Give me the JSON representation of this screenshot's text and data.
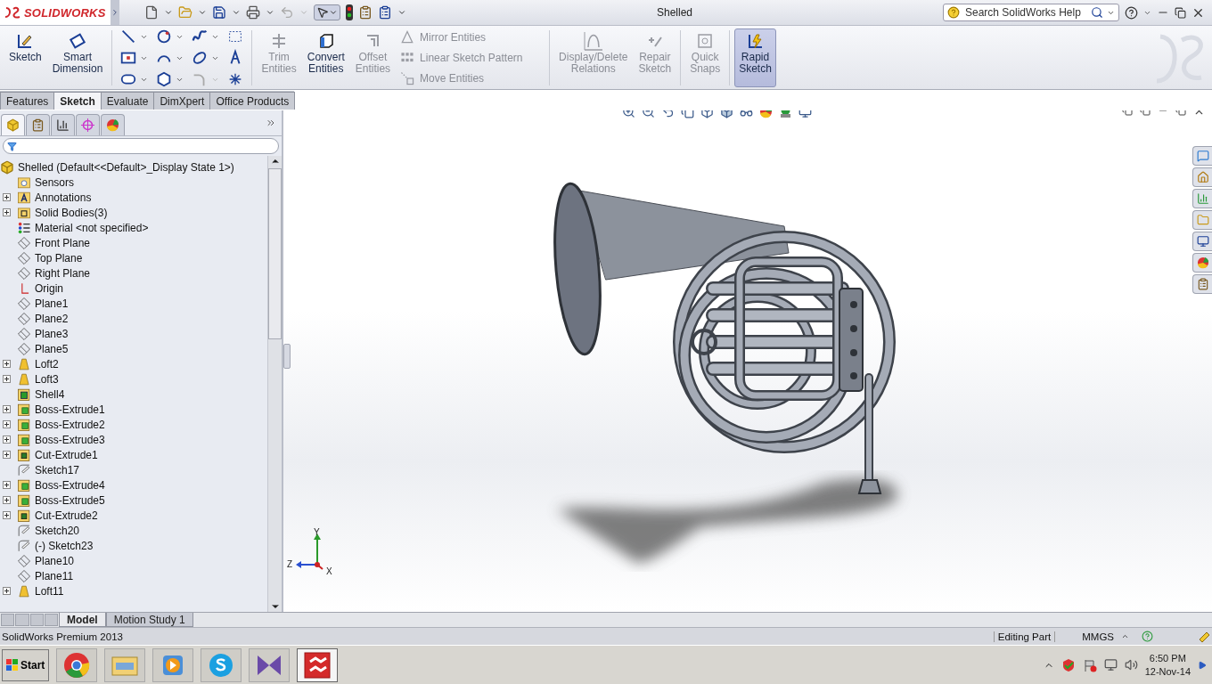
{
  "app": {
    "logo": "SOLIDWORKS",
    "title": "Shelled"
  },
  "search": {
    "placeholder": "Search SolidWorks Help"
  },
  "commands": [
    {
      "kind": "large",
      "label": "Sketch",
      "disabled": false,
      "on": false
    },
    {
      "kind": "large",
      "label": "Smart Dimension",
      "disabled": false,
      "on": false
    },
    {
      "kind": "tools"
    },
    {
      "kind": "large",
      "label": "Trim Entities",
      "disabled": true,
      "on": false
    },
    {
      "kind": "large",
      "label": "Convert Entities",
      "disabled": false,
      "on": false
    },
    {
      "kind": "large",
      "label": "Offset Entities",
      "disabled": true,
      "on": false
    },
    {
      "kind": "list",
      "items": [
        {
          "label": "Mirror Entities",
          "disabled": true
        },
        {
          "label": "Linear Sketch Pattern",
          "disabled": true
        },
        {
          "label": "Move Entities",
          "disabled": true
        }
      ]
    },
    {
      "kind": "large",
      "label": "Display/Delete Relations",
      "disabled": true,
      "on": false
    },
    {
      "kind": "large",
      "label": "Repair Sketch",
      "disabled": true,
      "on": false
    },
    {
      "kind": "large",
      "label": "Quick Snaps",
      "disabled": true,
      "on": false
    },
    {
      "kind": "large",
      "label": "Rapid Sketch",
      "disabled": false,
      "on": true
    }
  ],
  "tabs": [
    {
      "label": "Features",
      "selected": false
    },
    {
      "label": "Sketch",
      "selected": true
    },
    {
      "label": "Evaluate",
      "selected": false
    },
    {
      "label": "DimXpert",
      "selected": false
    },
    {
      "label": "Office Products",
      "selected": false
    }
  ],
  "tree": {
    "root": "Shelled  (Default<<Default>_Display State 1>)",
    "items": [
      {
        "kind": "sensor",
        "label": "Sensors",
        "collapsed": false
      },
      {
        "kind": "annotation",
        "label": "Annotations",
        "collapsed": true
      },
      {
        "kind": "bodies",
        "label": "Solid Bodies(3)",
        "collapsed": true
      },
      {
        "kind": "material",
        "label": "Material <not specified>",
        "collapsed": false
      },
      {
        "kind": "plane",
        "label": "Front Plane",
        "collapsed": false
      },
      {
        "kind": "plane",
        "label": "Top Plane",
        "collapsed": false
      },
      {
        "kind": "plane",
        "label": "Right Plane",
        "collapsed": false
      },
      {
        "kind": "origin",
        "label": "Origin",
        "collapsed": false
      },
      {
        "kind": "plane",
        "label": "Plane1",
        "collapsed": false
      },
      {
        "kind": "plane",
        "label": "Plane2",
        "collapsed": false
      },
      {
        "kind": "plane",
        "label": "Plane3",
        "collapsed": false
      },
      {
        "kind": "plane",
        "label": "Plane5",
        "collapsed": false
      },
      {
        "kind": "loft",
        "label": "Loft2",
        "collapsed": true
      },
      {
        "kind": "loft",
        "label": "Loft3",
        "collapsed": true
      },
      {
        "kind": "shell",
        "label": "Shell4",
        "collapsed": false
      },
      {
        "kind": "extrude",
        "label": "Boss-Extrude1",
        "collapsed": true
      },
      {
        "kind": "extrude",
        "label": "Boss-Extrude2",
        "collapsed": true
      },
      {
        "kind": "extrude",
        "label": "Boss-Extrude3",
        "collapsed": true
      },
      {
        "kind": "cut",
        "label": "Cut-Extrude1",
        "collapsed": true
      },
      {
        "kind": "sketch",
        "label": "Sketch17",
        "collapsed": false
      },
      {
        "kind": "extrude",
        "label": "Boss-Extrude4",
        "collapsed": true
      },
      {
        "kind": "extrude",
        "label": "Boss-Extrude5",
        "collapsed": true
      },
      {
        "kind": "cut",
        "label": "Cut-Extrude2",
        "collapsed": true
      },
      {
        "kind": "sketch",
        "label": "Sketch20",
        "collapsed": false
      },
      {
        "kind": "sketch",
        "label": "(-) Sketch23",
        "collapsed": false
      },
      {
        "kind": "plane",
        "label": "Plane10",
        "collapsed": false
      },
      {
        "kind": "plane",
        "label": "Plane11",
        "collapsed": false
      },
      {
        "kind": "loft",
        "label": "Loft11",
        "collapsed": true
      }
    ]
  },
  "triad": {
    "y": "Y",
    "z": "Z",
    "x": "X"
  },
  "bottom_tabs": [
    {
      "label": "Model",
      "selected": true
    },
    {
      "label": "Motion Study 1",
      "selected": false
    }
  ],
  "status_bar": {
    "product": "SolidWorks Premium 2013",
    "mode": "Editing Part",
    "units": "MMGS"
  },
  "taskbar": {
    "start": "Start",
    "apps": [
      {
        "kind": "chrome",
        "selected": false
      },
      {
        "kind": "explorer",
        "selected": false
      },
      {
        "kind": "media",
        "selected": false
      },
      {
        "kind": "skype",
        "selected": false
      },
      {
        "kind": "studio",
        "selected": false
      },
      {
        "kind": "solidworks",
        "selected": true
      }
    ],
    "time": "6:50 PM",
    "date": "12-Nov-14"
  }
}
